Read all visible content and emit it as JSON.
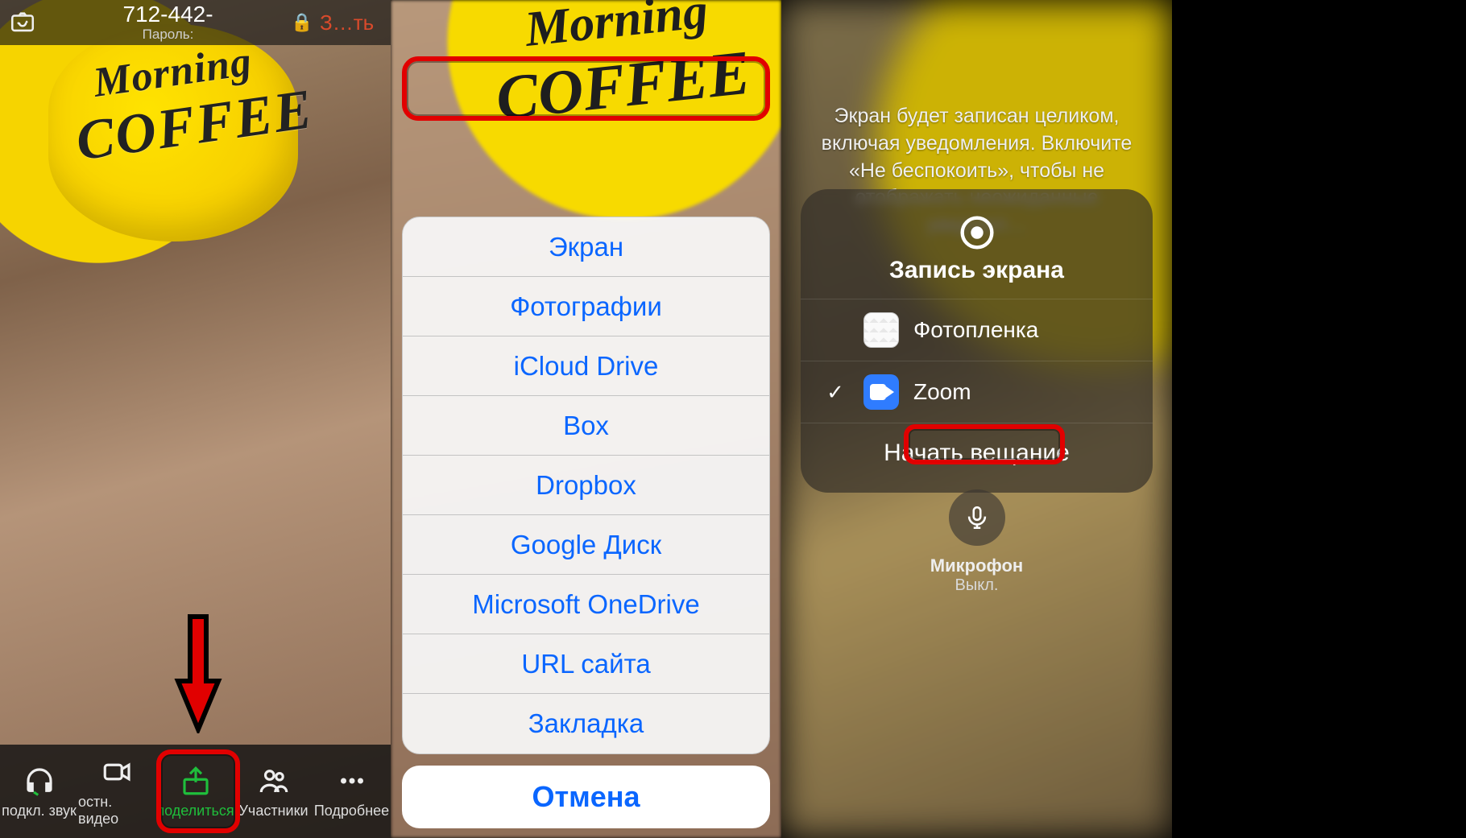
{
  "panel1": {
    "meeting_id": "712-442-",
    "password_label": "Пароль:",
    "end_label": "З…ть",
    "mug_line1": "Morning",
    "mug_line2": "COFFEE",
    "toolbar": {
      "audio": "подкл. звук",
      "video": "остн. видео",
      "share": "поделиться",
      "participants": "Участники",
      "more": "Подробнее"
    }
  },
  "panel2": {
    "mug_line1": "Morning",
    "mug_line2": "COFFEE",
    "options": [
      "Экран",
      "Фотографии",
      "iCloud Drive",
      "Box",
      "Dropbox",
      "Google Диск",
      "Microsoft OneDrive",
      "URL сайта",
      "Закладка"
    ],
    "cancel": "Отмена"
  },
  "panel3": {
    "description": "Экран будет записан целиком, включая уведомления. Включите «Не беспокоить», чтобы не отображать неожиданные уведомл…",
    "card_title": "Запись экрана",
    "apps": {
      "photos": "Фотопленка",
      "zoom": "Zoom"
    },
    "start": "Начать вещание",
    "mic_label": "Микрофон",
    "mic_state": "Выкл."
  }
}
